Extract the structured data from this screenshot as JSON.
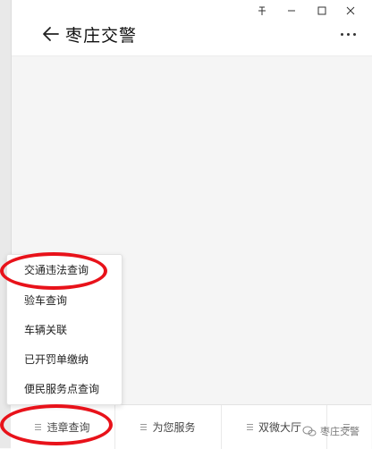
{
  "window": {
    "controls": {
      "pin": "ꟷ"
    },
    "title": "枣庄交警"
  },
  "menu": {
    "items": [
      {
        "label": "交通违法查询"
      },
      {
        "label": "验车查询"
      },
      {
        "label": "车辆关联"
      },
      {
        "label": "已开罚单缴纳"
      },
      {
        "label": "便民服务点查询"
      }
    ]
  },
  "tabbar": {
    "tabs": [
      {
        "label": "违章查询"
      },
      {
        "label": "为您服务"
      },
      {
        "label": "双微大厅"
      }
    ]
  },
  "watermark": {
    "text": "枣庄交警"
  },
  "colors": {
    "highlight_ring": "#e8121a"
  }
}
